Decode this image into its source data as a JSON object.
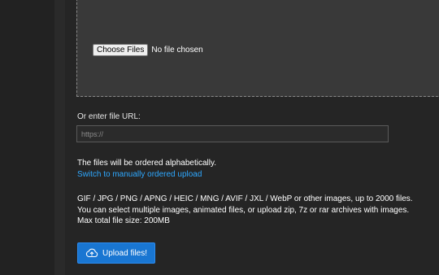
{
  "dropzone": {
    "choose_button": "Choose Files",
    "no_file_text": "No file chosen"
  },
  "url": {
    "label": "Or enter file URL:",
    "placeholder": "https://"
  },
  "ordering": {
    "text": "The files will be ordered alphabetically.",
    "link": "Switch to manually ordered upload"
  },
  "info": {
    "line1": "GIF / JPG / PNG / APNG / HEIC / MNG / AVIF / JXL / WebP or other images, up to 2000 files.",
    "line2": "You can select multiple images, animated files, or upload zip, 7z or rar archives with images.",
    "line3": "Max total file size: 200MB"
  },
  "upload": {
    "label": "Upload files!",
    "icon": "cloud-upload-icon"
  },
  "colors": {
    "accent": "#1976d2",
    "link": "#2ea8ff",
    "background": "#252525"
  }
}
